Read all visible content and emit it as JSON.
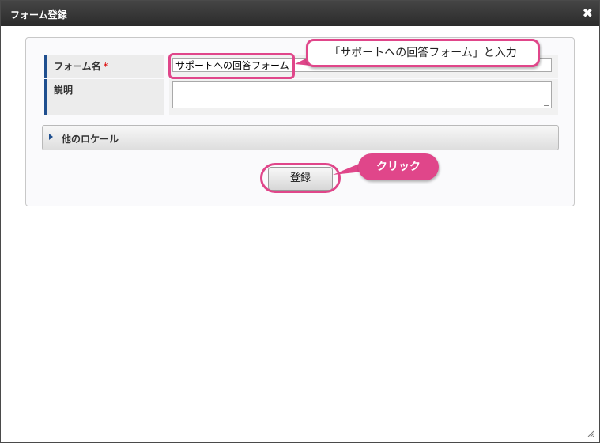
{
  "dialog": {
    "title": "フォーム登録",
    "close_glyph": "✖"
  },
  "form": {
    "name_label": "フォーム名",
    "required_mark": "*",
    "name_value": "サポートへの回答フォーム",
    "description_label": "説明",
    "description_value": "",
    "other_locale_label": "他のロケール",
    "submit_label": "登録"
  },
  "annotations": {
    "input_hint": "「サポートへの回答フォーム」と入力",
    "click_hint": "クリック",
    "highlight_color": "#e0468a"
  },
  "icons": {
    "close": "close-icon",
    "expand": "triangle-right-icon"
  }
}
